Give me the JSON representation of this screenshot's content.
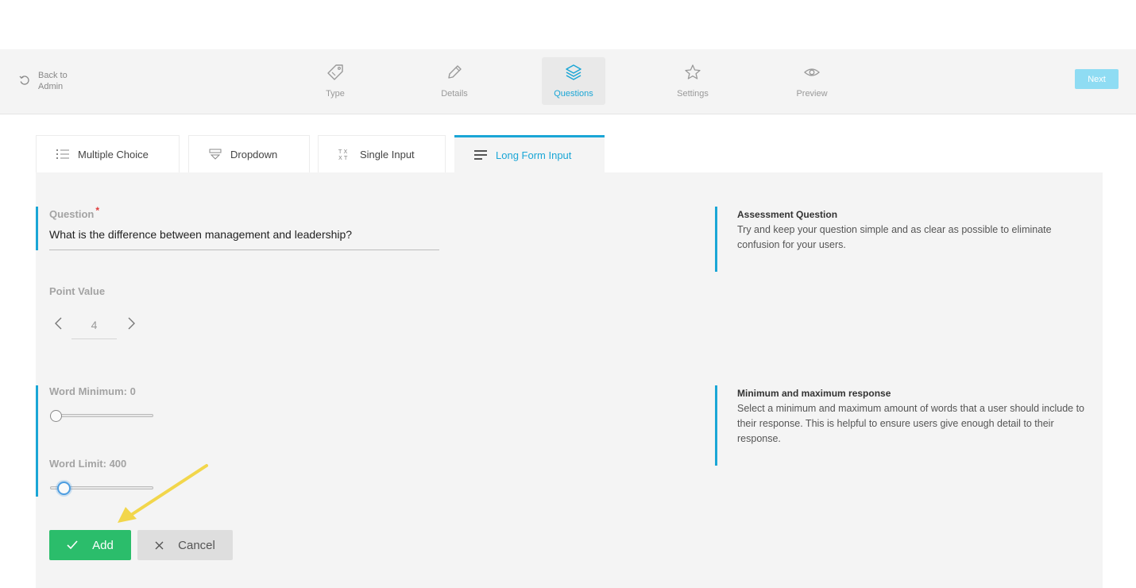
{
  "header": {
    "back_label_line1": "Back to",
    "back_label_line2": "Admin",
    "steps": [
      {
        "label": "Type",
        "icon": "tag-icon"
      },
      {
        "label": "Details",
        "icon": "pencil-icon"
      },
      {
        "label": "Questions",
        "icon": "layers-icon",
        "active": true
      },
      {
        "label": "Settings",
        "icon": "star-icon"
      },
      {
        "label": "Preview",
        "icon": "eye-icon"
      }
    ],
    "next_label": "Next"
  },
  "tabs": [
    {
      "label": "Multiple Choice",
      "icon": "list-icon"
    },
    {
      "label": "Dropdown",
      "icon": "dropdown-icon"
    },
    {
      "label": "Single Input",
      "icon": "text-icon"
    },
    {
      "label": "Long Form Input",
      "icon": "paragraph-icon",
      "active": true
    }
  ],
  "form": {
    "question_label": "Question",
    "required_mark": "*",
    "question_value": "What is the difference between management and leadership?",
    "point_value_label": "Point Value",
    "point_value": "4",
    "word_minimum_label": "Word Minimum: 0",
    "word_minimum_value": 0,
    "word_limit_label": "Word Limit: 400",
    "word_limit_value": 400,
    "add_label": "Add",
    "cancel_label": "Cancel"
  },
  "help": {
    "assessment_title": "Assessment Question",
    "assessment_text": "Try and keep your question simple and as clear as possible to eliminate confusion for your users.",
    "minmax_title": "Minimum and maximum response",
    "minmax_text": "Select a minimum and maximum amount of words that a user should include to their response. This is helpful to ensure users give enough detail to their response."
  },
  "colors": {
    "accent": "#1aa6d6",
    "add_button": "#2bbd6b",
    "next_button": "#8fdcf3",
    "annotation_arrow": "#f2d64b"
  }
}
